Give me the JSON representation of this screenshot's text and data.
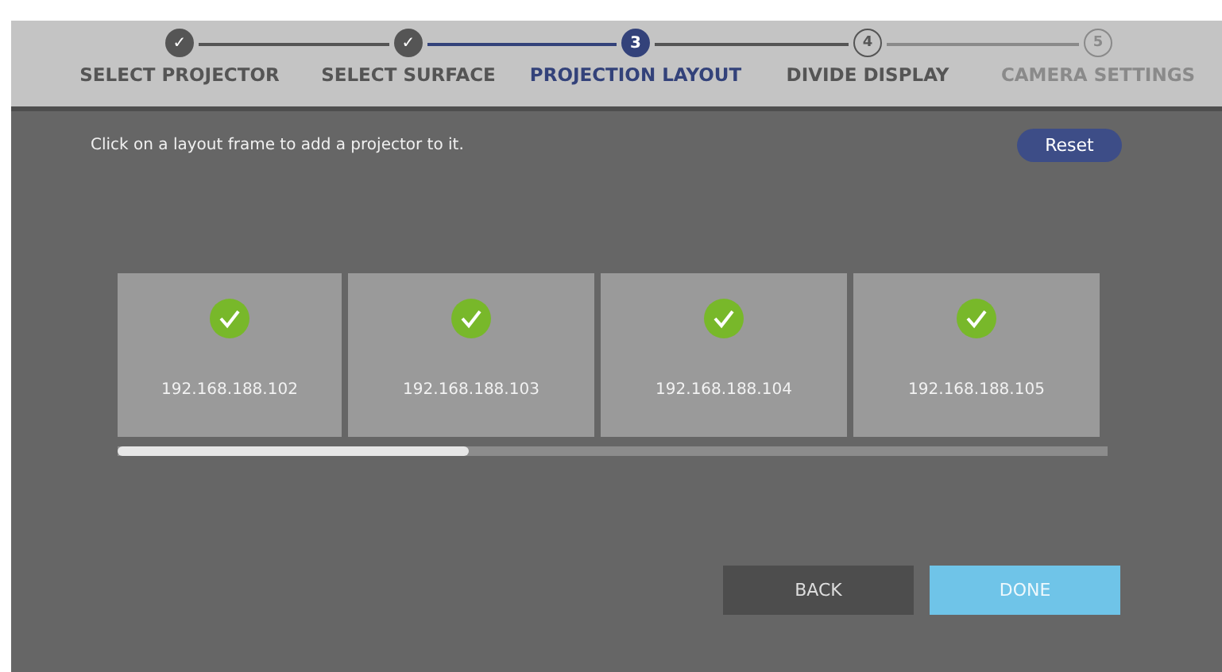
{
  "steps": [
    {
      "number": "✓",
      "label": "SELECT PROJECTOR",
      "kind": "done"
    },
    {
      "number": "✓",
      "label": "SELECT SURFACE",
      "kind": "done"
    },
    {
      "number": "3",
      "label": "PROJECTION LAYOUT",
      "kind": "current"
    },
    {
      "number": "4",
      "label": "DIVIDE DISPLAY",
      "kind": "upcoming"
    },
    {
      "number": "5",
      "label": "CAMERA SETTINGS",
      "kind": "disabled"
    }
  ],
  "instruction": "Click on a layout frame to add a projector to it.",
  "reset_button": "Reset",
  "frames": [
    {
      "address": "192.168.188.102",
      "assigned": true
    },
    {
      "address": "192.168.188.103",
      "assigned": true
    },
    {
      "address": "192.168.188.104",
      "assigned": true
    },
    {
      "address": "192.168.188.105",
      "assigned": true
    }
  ],
  "buttons": [
    {
      "label": "BACK",
      "kind": "secondary"
    },
    {
      "label": "DONE",
      "kind": "primary"
    }
  ]
}
